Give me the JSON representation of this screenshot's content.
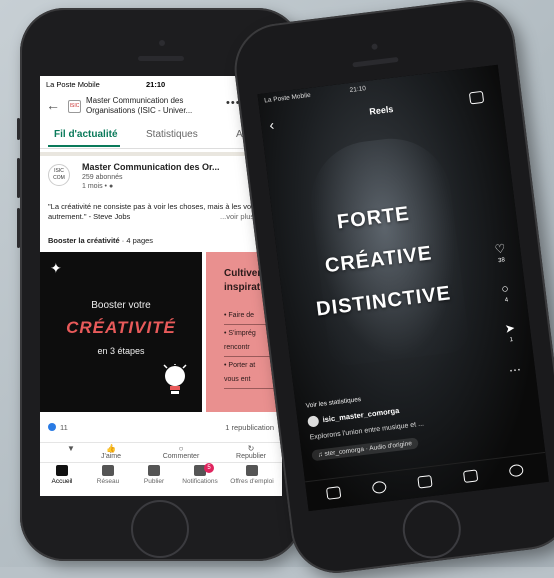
{
  "linkedin": {
    "status_carrier": "La Poste Mobile",
    "status_time": "21:10",
    "page_title": "Master Communication des Organisations (ISIC - Univer...",
    "tabs": [
      "Fil d'actualité",
      "Statistiques",
      "Activité"
    ],
    "post": {
      "author": "Master Communication des Or...",
      "followers": "259 abonnés",
      "age": "1 mois • ",
      "text": "\"La créativité ne consiste pas à voir les choses, mais à les voir autrement.\" - Steve Jobs",
      "more": "...voir plus",
      "doc_title": "Booster la créativité",
      "doc_pages": " · 4 pages",
      "slide1_line1": "Booster votre",
      "slide1_line2": "CRÉATIVITÉ",
      "slide1_line3": "en 3 étapes",
      "slide2_title1": "Cultiver",
      "slide2_title2": "inspirat",
      "slide2_bullets": [
        "• Faire de",
        "• S'imprég",
        "rencontr",
        "• Porter at",
        "vous ent"
      ],
      "reactions": "11",
      "reposts": "1 republication"
    },
    "actions": [
      "J'aime",
      "Commenter",
      "Republier"
    ],
    "nav": [
      "Accueil",
      "Réseau",
      "Publier",
      "Notifications",
      "Offres d'emploi"
    ],
    "notif_badge": "5",
    "logo_text": "ISIC COM"
  },
  "instagram": {
    "status_carrier": "La Poste Mobile",
    "status_time": "21:10",
    "title": "Reels",
    "overlay": [
      "FORTE",
      "CRÉATIVE",
      "DISTINCTIVE"
    ],
    "likes": "38",
    "comments": "4",
    "shares": "1",
    "stats_link": "Voir les statistiques",
    "username": "isic_master_comorga",
    "caption": "Explorons l'union entre musique et ...",
    "audio": "ster_comorga · Audio d'origine"
  }
}
